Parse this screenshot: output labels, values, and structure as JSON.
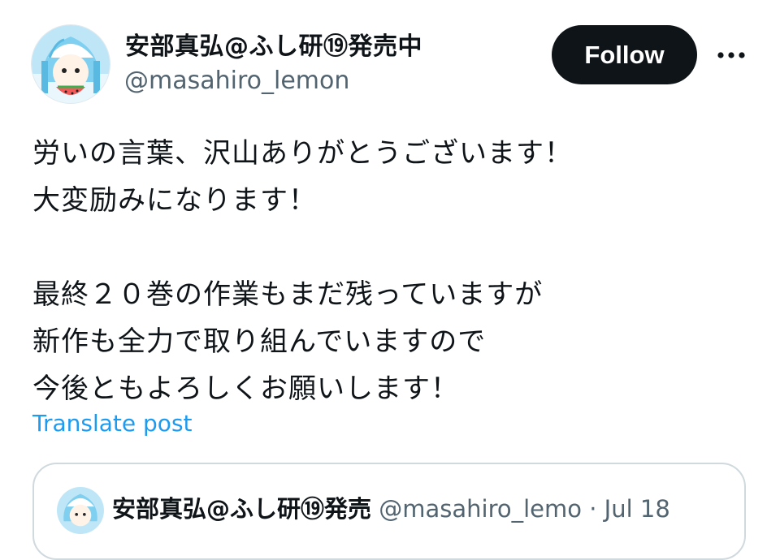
{
  "author": {
    "display_name": "安部真弘@ふし研⑲発売中",
    "handle": "@masahiro_lemon",
    "avatar_icon": "squid-girl-avatar-icon"
  },
  "actions": {
    "follow_label": "Follow",
    "more_icon": "more-horizontal-icon"
  },
  "tweet": {
    "lines": [
      "労いの言葉、沢山ありがとうございます！",
      "大変励みになります！",
      "",
      "最終２０巻の作業もまだ残っていますが",
      "新作も全力で取り組んでいますので",
      "今後ともよろしくお願いします！"
    ],
    "translate_label": "Translate post"
  },
  "quote": {
    "display_name": "安部真弘@ふし研⑲発売",
    "handle": "@masahiro_lemo",
    "separator": "·",
    "date": "Jul 18"
  },
  "colors": {
    "text": "#0f1419",
    "secondary": "#536471",
    "link": "#1d9bf0",
    "button_bg": "#0f1419",
    "border": "#cfd9de"
  }
}
